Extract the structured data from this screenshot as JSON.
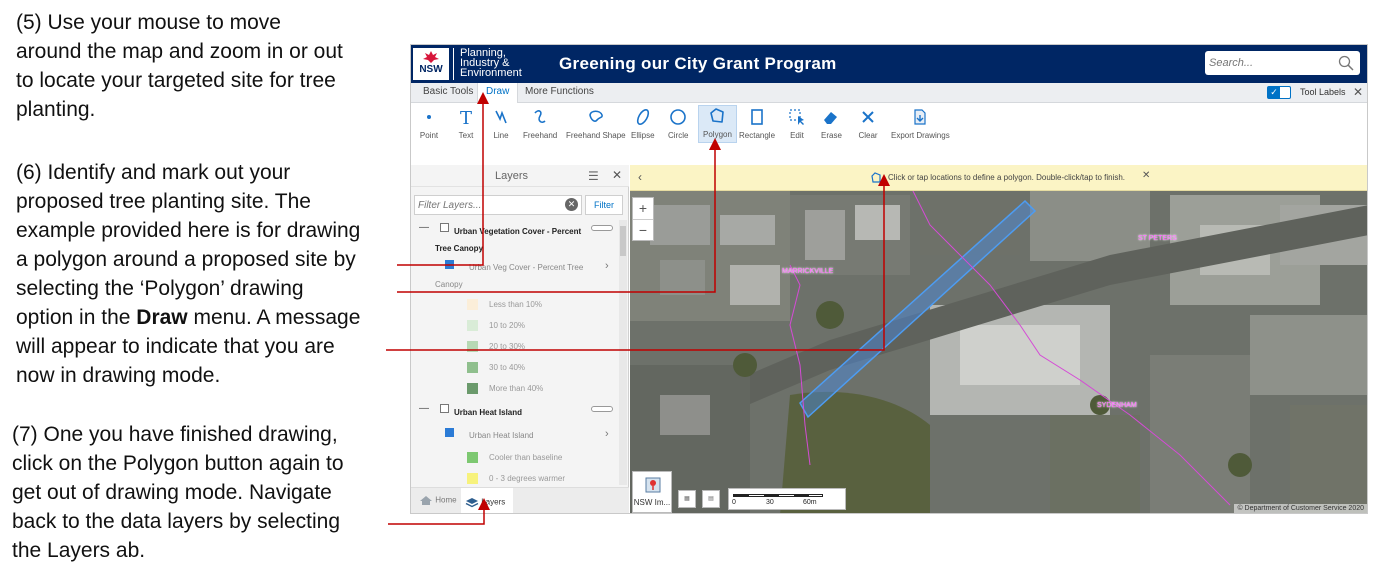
{
  "instructions": {
    "step5": [
      "(5) Use your mouse to move",
      "around the map and zoom in or out",
      "to locate your targeted site for tree",
      "planting."
    ],
    "step6": [
      "(6) Identify and mark out your",
      "proposed tree planting site. The",
      "example provided here is for drawing",
      "a polygon around a proposed site by",
      "selecting the ‘Polygon’ drawing",
      "option in the",
      "Draw",
      "menu. A message",
      "will appear to indicate that you are",
      "now in drawing mode."
    ],
    "step7": [
      "(7) One you have finished drawing,",
      "click on the Polygon button again to",
      "get out of drawing mode. Navigate",
      "back to the data layers by selecting",
      "the Layers ab."
    ]
  },
  "header": {
    "logo_text": "NSW",
    "dept_lines": [
      "Planning,",
      "Industry &",
      "Environment"
    ],
    "title": "Greening our City Grant Program",
    "search_placeholder": "Search..."
  },
  "tabs": [
    {
      "label": "Basic Tools"
    },
    {
      "label": "Draw"
    },
    {
      "label": "More Functions"
    }
  ],
  "tool_labels_toggle": {
    "label": "Tool Labels",
    "checked": true
  },
  "tools": [
    {
      "label": "Point",
      "icon": "point-icon"
    },
    {
      "label": "Text",
      "icon": "text-icon"
    },
    {
      "label": "Line",
      "icon": "line-icon"
    },
    {
      "label": "Freehand",
      "icon": "freehand-icon"
    },
    {
      "label": "Freehand Shape",
      "icon": "freehand-shape-icon"
    },
    {
      "label": "Ellipse",
      "icon": "ellipse-icon"
    },
    {
      "label": "Circle",
      "icon": "circle-icon"
    },
    {
      "label": "Polygon",
      "icon": "polygon-icon"
    },
    {
      "label": "Rectangle",
      "icon": "rectangle-icon"
    },
    {
      "label": "Edit",
      "icon": "edit-icon"
    },
    {
      "label": "Erase",
      "icon": "eraser-icon"
    },
    {
      "label": "Clear",
      "icon": "close-icon"
    },
    {
      "label": "Export Drawings",
      "icon": "export-icon"
    }
  ],
  "layers_panel": {
    "title": "Layers",
    "filter_placeholder": "Filter Layers...",
    "filter_button": "Filter",
    "groups": [
      {
        "label": "Urban Vegetation Cover - Percent",
        "label2": "Tree Canopy",
        "sub": "Urban Veg Cover - Percent Tree",
        "sub2": "Canopy"
      },
      {
        "label": "Urban Heat Island",
        "sub": "Urban Heat Island"
      }
    ],
    "legend1": [
      {
        "label": "Less than 10%",
        "color": "#fbeed9"
      },
      {
        "label": "10 to 20%",
        "color": "#d9ecd7"
      },
      {
        "label": "20 to 30%",
        "color": "#b7d9b4"
      },
      {
        "label": "30 to 40%",
        "color": "#8fbf8d"
      },
      {
        "label": "More than 40%",
        "color": "#6b9a6c"
      }
    ],
    "legend2": [
      {
        "label": "Cooler than baseline",
        "color": "#7dc871"
      },
      {
        "label": "0 - 3 degrees warmer",
        "color": "#f7f27c"
      }
    ],
    "footer_tabs": [
      "Home",
      "Layers"
    ]
  },
  "map": {
    "message": "Click or tap locations to define a polygon. Double-click/tap to finish.",
    "suburbs": [
      "MARRICKVILLE",
      "ST PETERS",
      "SYDENHAM"
    ],
    "basemap_label": "NSW Im...",
    "scale_ticks": [
      "0",
      "30",
      "60m"
    ],
    "copyright": "© Department of Customer Service 2020"
  },
  "colors": {
    "header": "#002664",
    "accent": "#0072c6",
    "annotation_arrow": "#c00000",
    "message_bg": "#fbf4c5"
  }
}
